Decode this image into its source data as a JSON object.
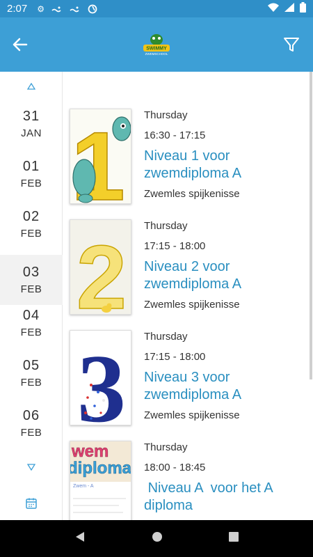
{
  "status_bar": {
    "time": "2:07"
  },
  "dates": [
    {
      "day": "31",
      "month": "JAN",
      "selected": false
    },
    {
      "day": "01",
      "month": "FEB",
      "selected": false
    },
    {
      "day": "02",
      "month": "FEB",
      "selected": false
    },
    {
      "day": "03",
      "month": "FEB",
      "selected": true
    },
    {
      "day": "04",
      "month": "FEB",
      "selected": false
    },
    {
      "day": "05",
      "month": "FEB",
      "selected": false
    },
    {
      "day": "06",
      "month": "FEB",
      "selected": false
    }
  ],
  "events": [
    {
      "weekday": "Thursday",
      "time": "16:30  -  17:15",
      "title": "Niveau 1 voor zwemdiploma A",
      "location": "Zwemles spijkenisse"
    },
    {
      "weekday": "Thursday",
      "time": "17:15  -  18:00",
      "title": "Niveau 2 voor zwemdiploma A",
      "location": "Zwemles spijkenisse"
    },
    {
      "weekday": "Thursday",
      "time": "17:15  -  18:00",
      "title": "Niveau 3 voor zwemdiploma A",
      "location": "Zwemles spijkenisse"
    },
    {
      "weekday": "Thursday",
      "time": "18:00  -  18:45",
      "title": " Niveau A  voor het A diploma",
      "location": ""
    }
  ],
  "thumbs": [
    {
      "glyph": "1"
    },
    {
      "glyph": "2"
    },
    {
      "glyph": "3"
    },
    {
      "glyph": "wem\ndiploma",
      "mark_line": "Zwem - A"
    }
  ],
  "logo": {
    "text": "SWIMMY\nZWEMSCHOOL"
  },
  "colors": {
    "app_bar": "#3d9fd6",
    "status_bar": "#2f8fc8",
    "title": "#2a8fc0"
  },
  "icons": {
    "back": "arrow-left-icon",
    "filter": "funnel-icon",
    "scroll_up": "triangle-up-icon",
    "scroll_down": "triangle-down-icon",
    "calendar": "calendar-icon"
  }
}
